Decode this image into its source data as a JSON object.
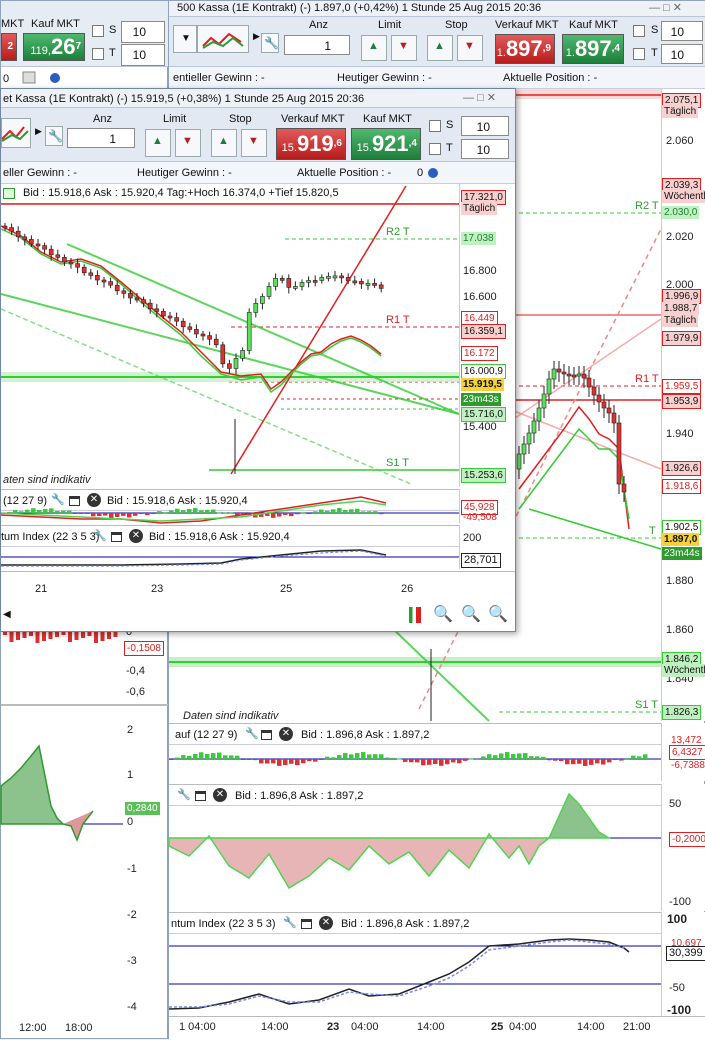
{
  "back": {
    "title": "500 Kassa (1E Kontrakt) (-)   1.897,0 (+0,42%)   1 Stunde  25 Aug 2015 20:36",
    "anz": "Anz",
    "limit": "Limit",
    "stop": "Stop",
    "verkauf": "Verkauf MKT",
    "kauf": "Kauf MKT",
    "qty": "1",
    "sell_small": "1.",
    "sell_big": "897",
    "sell_sup": ",9",
    "buy_small": "1.",
    "buy_big": "897",
    "buy_sup": ",4",
    "s": "S",
    "t": "T",
    "s_val": "10",
    "t_val": "10",
    "gewinn": "entieller Gewinn : -",
    "heutiger": "Heutiger Gewinn : -",
    "position": "Aktuelle Position : -",
    "indikativ": "Daten sind indikativ",
    "macd": "auf (12 27 9)",
    "macd_bidask": "Bid : 1.896,8 Ask : 1.897,2",
    "osc_bidask": "Bid : 1.896,8 Ask : 1.897,2",
    "mom": "ntum Index (22 3 5 3)",
    "mom_bidask": "Bid : 1.896,8 Ask : 1.897,2",
    "r1": "R1 T",
    "r2": "R2 T",
    "s1": "S1 T",
    "t_right": "T",
    "axis": [
      "2.060",
      "2.020",
      "2.000",
      "1.940",
      "1.880",
      "1.860",
      "1.840"
    ],
    "tags": {
      "a": "2.075,1",
      "a2": "Täglich",
      "b": "2.039,3",
      "b2": "Wöchentl",
      "c": "2.030,0",
      "d": "1.996,9",
      "e": "1.988,7",
      "e2": "Täglich",
      "f": "1.979,9",
      "g": "1.959,5",
      "h": "1.953,9",
      "i": "1.926,6",
      "j": "1.918,6",
      "k": "1.902,5",
      "l": "1.897,0",
      "m": "23m44s",
      "n": "1.846,2",
      "n2": "Wöchentl",
      "o": "1.826,3"
    },
    "macd_axis": [
      "13,472",
      "6,4327",
      "-6,7388"
    ],
    "osc_axis": [
      "50",
      "-0,2000",
      "-100"
    ],
    "mom_axis": [
      "100",
      "30,399",
      "-50",
      "-100",
      "10,697"
    ],
    "xaxis": [
      "1  04:00",
      "14:00",
      "23",
      "04:00",
      "14:00",
      "25",
      "04:00",
      "14:00",
      "21:00"
    ]
  },
  "left": {
    "kauf": "Kauf MKT",
    "mkt": "MKT",
    "buy_small": "119,",
    "buy_big": "26",
    "buy_sup": "7",
    "sell_sup": "2",
    "s": "S",
    "t": "T",
    "s_val": "10",
    "t_val": "10",
    "val": "0",
    "axis1": [
      "0",
      "-0,1508",
      "-0,4",
      "-0,6"
    ],
    "axis2": [
      "2",
      "1",
      "0,2840",
      "0",
      "-1",
      "-2",
      "-3",
      "-4"
    ],
    "xaxis": [
      "12:00",
      "18:00"
    ]
  },
  "front": {
    "title": "et Kassa (1E Kontrakt) (-)   15.919,5 (+0,38%)    1 Stunde  25 Aug 2015 20:36",
    "anz": "Anz",
    "limit": "Limit",
    "stop": "Stop",
    "verkauf": "Verkauf MKT",
    "kauf": "Kauf MKT",
    "qty": "1",
    "sell_small": "15.",
    "sell_big": "919",
    "sell_sup": ",6",
    "buy_small": "15.",
    "buy_big": "921",
    "buy_sup": ",4",
    "s": "S",
    "t": "T",
    "s_val": "10",
    "t_val": "10",
    "gewinn": "eller Gewinn : -",
    "heutiger": "Heutiger Gewinn : -",
    "position": "Aktuelle Position : -",
    "pos_val": "0",
    "bidask": "Bid : 15.918,6 Ask : 15.920,4 Tag:+Hoch 16.374,0 +Tief 15.820,5",
    "indikativ": "aten sind indikativ",
    "macd": "(12 27 9)",
    "macd_bidask": "Bid : 15.918,6 Ask : 15.920,4",
    "mom": "tum Index (22 3 5 3)",
    "mom_bidask": "Bid : 15.918,6 Ask : 15.920,4",
    "r1": "R1 T",
    "r2": "R2 T",
    "s1": "S1 T",
    "axis": [
      "16.800",
      "16.600",
      "16.000,9",
      "15.400",
      "15.200"
    ],
    "tags": {
      "a": "17.321,0",
      "a2": "Täglich",
      "b": "17.038",
      "c": "16.449",
      "d": "16.359,1",
      "e": "16.172",
      "f": "15.919,5",
      "g": "23m43s",
      "h": "15.716,0",
      "i": "15.253,6"
    },
    "macd_axis": [
      "45,928",
      "-49,508"
    ],
    "mom_axis": [
      "200",
      "28,701"
    ],
    "xaxis": [
      "21",
      "23",
      "25",
      "26"
    ]
  },
  "colors": {
    "red": "#e02020",
    "green": "#33cc33",
    "blue": "#0000aa"
  }
}
